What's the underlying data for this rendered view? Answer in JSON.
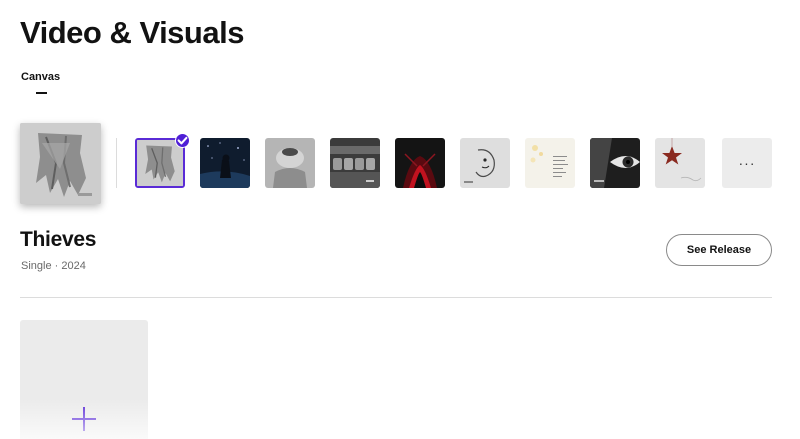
{
  "header": {
    "title": "Video & Visuals"
  },
  "tabs": [
    {
      "label": "Canvas",
      "active": true
    }
  ],
  "cover_options": {
    "selected_index": 0,
    "thumbnails": [
      {
        "name": "draped-cloth-cover"
      },
      {
        "name": "figure-under-stars-cover"
      },
      {
        "name": "blurred-face-cover"
      },
      {
        "name": "theater-seats-cover"
      },
      {
        "name": "red-glow-cover"
      },
      {
        "name": "line-drawing-face-cover"
      },
      {
        "name": "handwritten-note-cover"
      },
      {
        "name": "eye-closeup-cover"
      },
      {
        "name": "star-ornament-cover"
      }
    ],
    "more_label": "···"
  },
  "release": {
    "title": "Thieves",
    "subtitle": "Single · 2024",
    "see_release_label": "See Release"
  },
  "colors": {
    "accent": "#5a2bd6",
    "text_primary": "#121212",
    "text_secondary": "#6a6a6a",
    "divider": "#dcdcdc",
    "tile_background": "#ebebeb"
  }
}
